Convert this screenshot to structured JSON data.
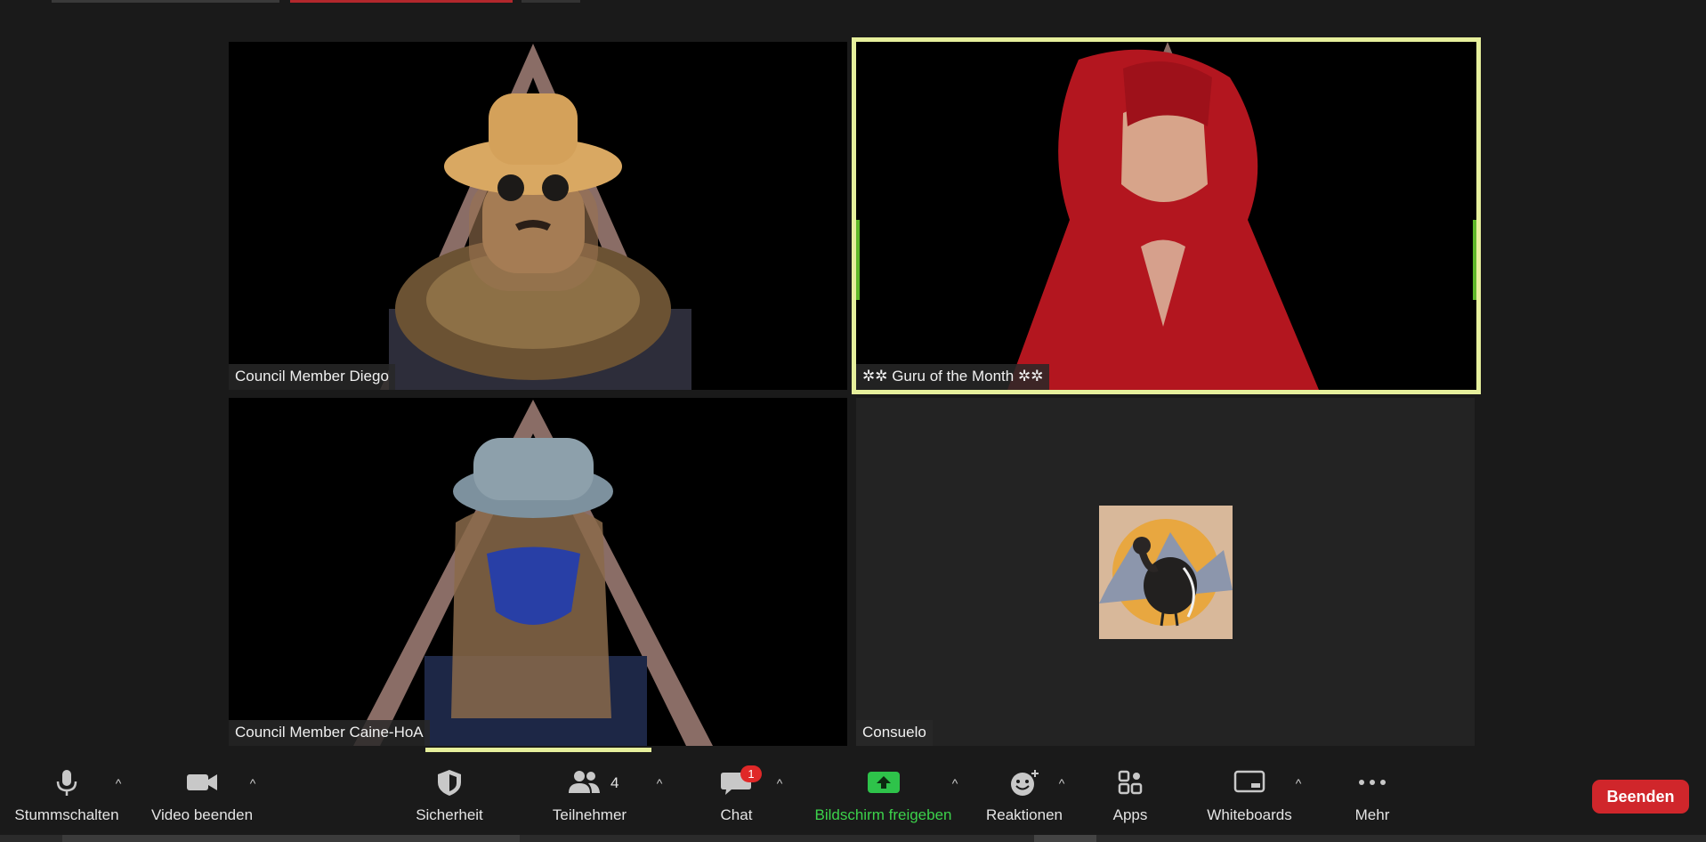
{
  "window": {
    "title": ""
  },
  "participants": [
    {
      "name": "Council Member Diego"
    },
    {
      "name": "✲✲ Guru of the Month ✲✲"
    },
    {
      "name": "Council Member Caine-HoA"
    },
    {
      "name": "Consuelo"
    }
  ],
  "toolbar": {
    "mute_label": "Stummschalten",
    "video_label": "Video beenden",
    "security_label": "Sicherheit",
    "participants_label": "Teilnehmer",
    "participants_count": "4",
    "chat_label": "Chat",
    "chat_badge": "1",
    "share_label": "Bildschirm freigeben",
    "reactions_label": "Reaktionen",
    "apps_label": "Apps",
    "whiteboards_label": "Whiteboards",
    "more_label": "Mehr",
    "end_label": "Beenden"
  },
  "colors": {
    "active_speaker_border": "#e6ef9c",
    "share_green": "#3cd24b",
    "end_red": "#d0262b",
    "badge_red": "#e02828"
  }
}
